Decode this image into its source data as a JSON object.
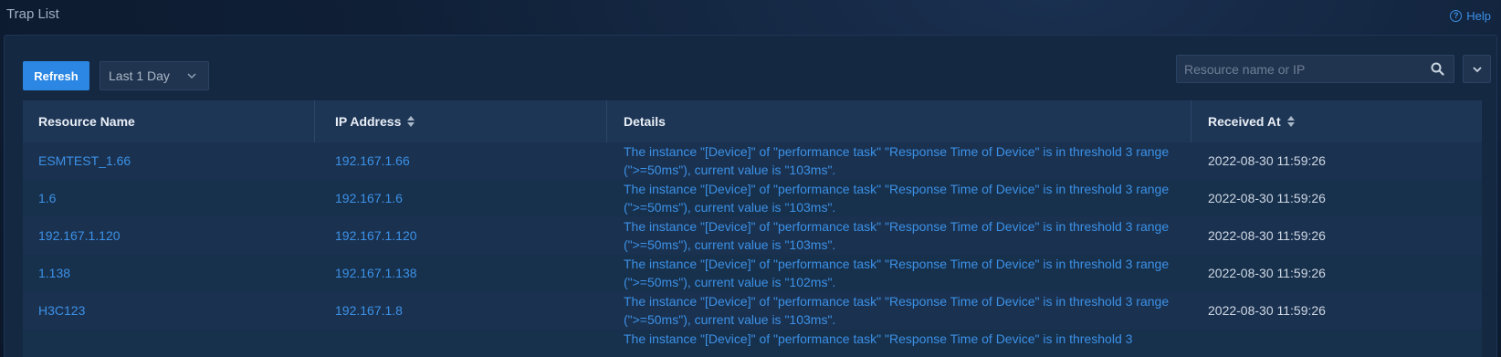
{
  "header": {
    "title": "Trap List",
    "help_label": "Help"
  },
  "toolbar": {
    "refresh_label": "Refresh",
    "time_range": "Last 1 Day",
    "search_placeholder": "Resource name or IP"
  },
  "table": {
    "columns": [
      "Resource Name",
      "IP Address",
      "Details",
      "Received At"
    ],
    "rows": [
      {
        "name": "ESMTEST_1.66",
        "ip": "192.167.1.66",
        "details": "The instance \"[Device]\" of \"performance task\" \"Response Time of Device\" is in threshold 3 range (\">=50ms\"), current value is \"103ms\".",
        "time": "2022-08-30 11:59:26"
      },
      {
        "name": "1.6",
        "ip": "192.167.1.6",
        "details": "The instance \"[Device]\" of \"performance task\" \"Response Time of Device\" is in threshold 3 range (\">=50ms\"), current value is \"103ms\".",
        "time": "2022-08-30 11:59:26"
      },
      {
        "name": "192.167.1.120",
        "ip": "192.167.1.120",
        "details": "The instance \"[Device]\" of \"performance task\" \"Response Time of Device\" is in threshold 3 range (\">=50ms\"), current value is \"103ms\".",
        "time": "2022-08-30 11:59:26"
      },
      {
        "name": "1.138",
        "ip": "192.167.1.138",
        "details": "The instance \"[Device]\" of \"performance task\" \"Response Time of Device\" is in threshold 3 range (\">=50ms\"), current value is \"102ms\".",
        "time": "2022-08-30 11:59:26"
      },
      {
        "name": "H3C123",
        "ip": "192.167.1.8",
        "details": "The instance \"[Device]\" of \"performance task\" \"Response Time of Device\" is in threshold 3 range (\">=50ms\"), current value is \"103ms\".",
        "time": "2022-08-30 11:59:26"
      },
      {
        "name": "",
        "ip": "",
        "details": "The instance \"[Device]\" of \"performance task\" \"Response Time of Device\" is in threshold 3",
        "time": ""
      }
    ]
  },
  "colors": {
    "accent": "#2b87e3",
    "link": "#3c91e6",
    "background": "#0f1f36"
  }
}
